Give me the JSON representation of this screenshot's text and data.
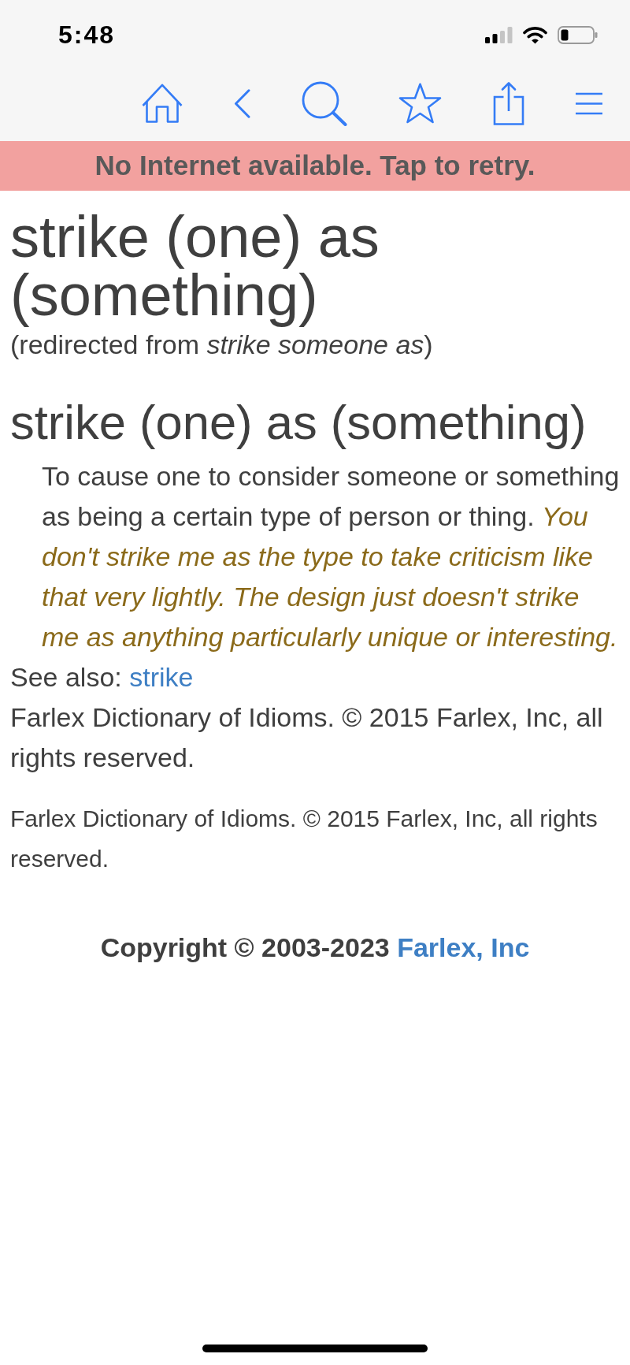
{
  "status_bar": {
    "time": "5:48"
  },
  "banner": {
    "text": "No Internet available. Tap to retry."
  },
  "entry": {
    "title": "strike (one) as (something)",
    "redirect": "(redirected from *strike someone as*)",
    "heading": "strike (one) as (something)",
    "definition": "To cause one to consider someone or something as being a certain type of person or thing.",
    "example": "You don't strike me as the type to take criticism like that very lightly. The design just doesn't strike me as anything particularly unique or interesting.",
    "see_also": {
      "label": "See also:",
      "link": "strike"
    },
    "source": "Farlex Dictionary of Idioms. © 2015 Farlex, Inc, all rights reserved."
  },
  "source_note": "Farlex Dictionary of Idioms. © 2015 Farlex, Inc, all rights reserved.",
  "footer": {
    "copyright": "Copyright © 2003-2023",
    "link": "Farlex, Inc"
  }
}
